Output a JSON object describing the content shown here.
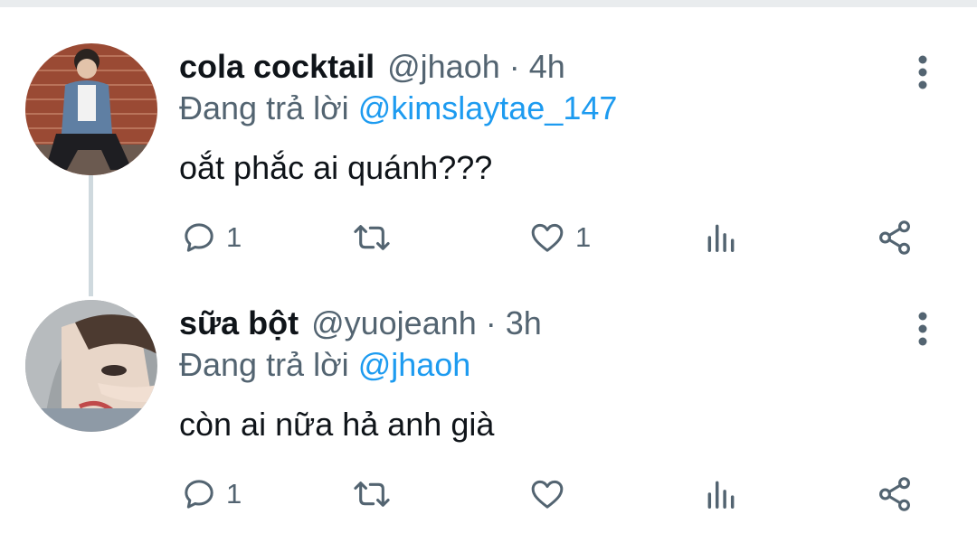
{
  "tweets": [
    {
      "name": "cola cocktail",
      "handle": "@jhaoh",
      "time": "4h",
      "reply_prefix": "Đang trả lời",
      "reply_to": "@kimslaytae_147",
      "text": "oắt phắc ai quánh???",
      "reply_count": "1",
      "retweet_count": "",
      "like_count": "1",
      "icons": [
        "reply-icon",
        "retweet-icon",
        "like-icon",
        "analytics-icon",
        "share-icon",
        "more-vertical-icon"
      ]
    },
    {
      "name": "sữa bột",
      "handle": "@yuojeanh",
      "time": "3h",
      "reply_prefix": "Đang trả lời",
      "reply_to": "@jhaoh",
      "text": "còn ai nữa hả anh già",
      "reply_count": "1",
      "retweet_count": "",
      "like_count": "",
      "icons": [
        "reply-icon",
        "retweet-icon",
        "like-icon",
        "analytics-icon",
        "share-icon",
        "more-vertical-icon"
      ]
    }
  ],
  "colors": {
    "mention": "#1d9bf0",
    "secondary": "#536471",
    "text": "#0f1419",
    "thread_line": "#cfd9de"
  }
}
